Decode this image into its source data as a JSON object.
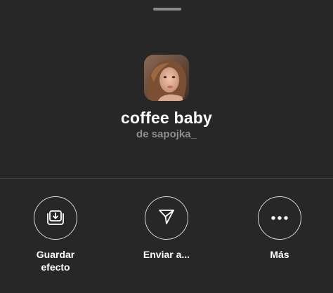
{
  "effect": {
    "title": "coffee baby",
    "author": "de sapojka_",
    "thumbnail": "portrait-thumbnail"
  },
  "actions": [
    {
      "label": "Guardar\nefecto",
      "icon": "save-icon"
    },
    {
      "label": "Enviar a...",
      "icon": "send-icon"
    },
    {
      "label": "Más",
      "icon": "more-icon"
    }
  ],
  "colors": {
    "background": "#272727",
    "text": "#ffffff",
    "secondary_text": "#8e8e8e",
    "icon_outline": "#d8d8d8"
  }
}
